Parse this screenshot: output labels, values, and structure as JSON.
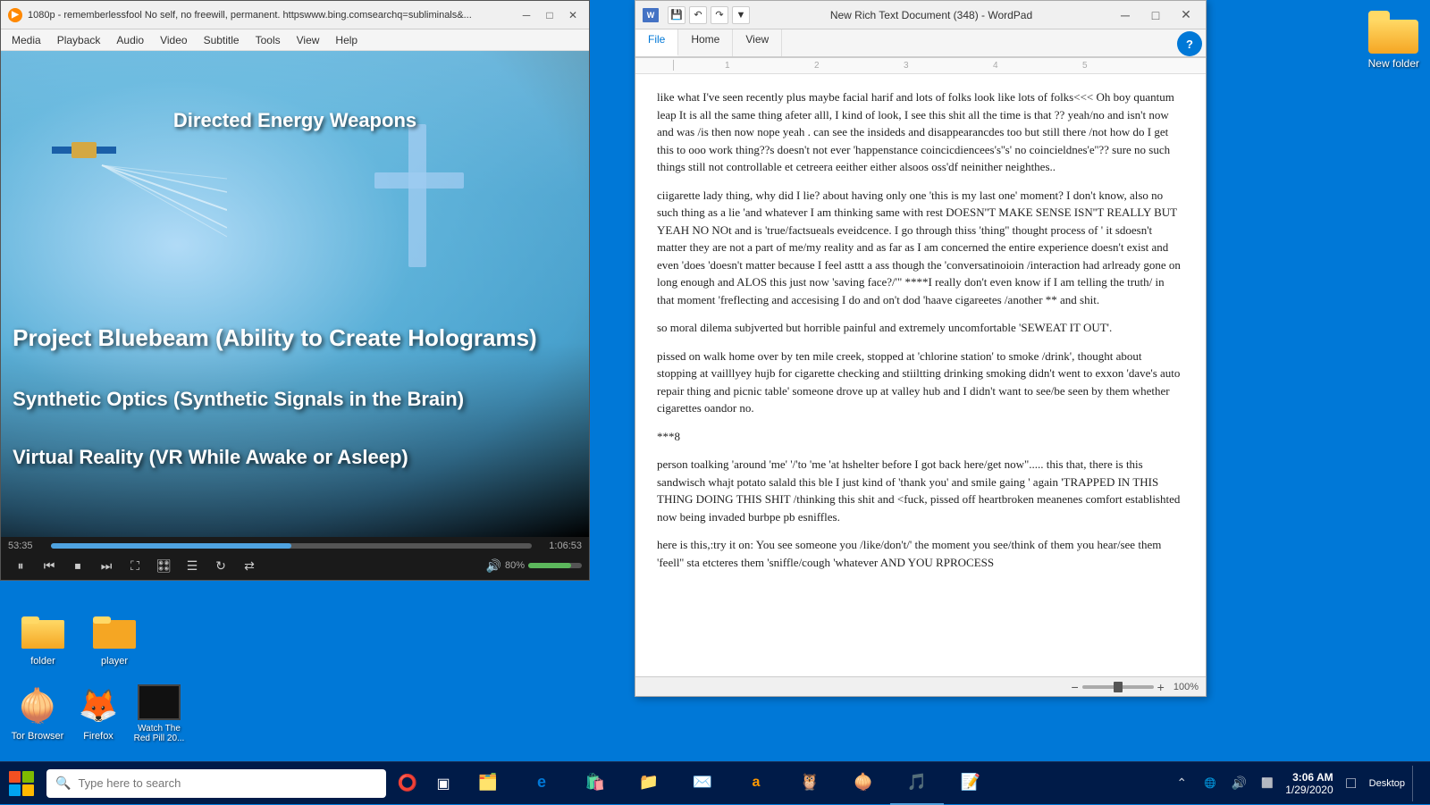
{
  "vlc": {
    "title": "1080p - rememberlessfool No self, no freewill, permanent. httpswww.bing.comsearchq=subliminals&...",
    "menu": {
      "items": [
        "Media",
        "Playback",
        "Audio",
        "Video",
        "Subtitle",
        "Tools",
        "View",
        "Help"
      ]
    },
    "video": {
      "text_directed": "Directed Energy Weapons",
      "text_project": "Project Bluebeam (Ability to Create Holograms)",
      "text_synthetic": "Synthetic Optics (Synthetic Signals in the Brain)",
      "text_vr": "Virtual Reality (VR While Awake or Asleep)"
    },
    "controls": {
      "current_time": "53:35",
      "total_time": "1:06:53",
      "volume_percent": "80%",
      "progress_percent": 50
    }
  },
  "wordpad": {
    "title": "New Rich Text Document (348) - WordPad",
    "tabs": [
      "File",
      "Home",
      "View"
    ],
    "active_tab": "File",
    "zoom_level": "100%",
    "content": [
      "like what I've seen recently plus maybe facial harif and lots of folks look like lots of folks<<< Oh boy quantum leap It is all the same thing afeter alll, I kind of look, I see this shit all the time is that ?? yeah/no and isn't now and was /is then now nope yeah . can see the insideds and disappearancdes too but still there /not how do I get this to ooo work thing??s doesn't not ever 'happenstance coincicdiencees's''s' no coincieldnes'e''?? sure no such things still not controllable et cetreera eeither either alsoos oss'df neinither neighthes..",
      "ciigarette lady thing, why did I lie? about having only one 'this is my last one' moment? I don't know, also no such thing as a lie 'and whatever I am thinking same with rest DOESN''T MAKE SENSE ISN''T REALLY BUT YEAH NO NOt and is 'true/factsueals eveidcence. I go through thiss 'thing'' thought process of ' it sdoesn't matter they are not a part of me/my reality and as far as I am concerned the entire experience doesn't exist and even 'does 'doesn't matter because I feel asttt a ass though the 'conversatinoioin /interaction had arlready gone on long enough and ALOS this just now 'saving face?/'\" ****I really don't even know if I am telling the truth/ in that moment 'freflecting and accesising I do and on't dod 'haave cigareetes /another ** and shit.",
      "so moral dilema subjverted but horrible painful and extremely uncomfortable 'SEWEAT IT OUT'.",
      "pissed on walk home over by ten mile creek, stopped at 'chlorine station' to smoke /drink', thought about stopping at vailllyey hujb for cigarette checking and stiiltting drinking smoking didn't went to exxon 'dave's auto repair thing and picnic table' someone drove up at valley hub and I didn't want to see/be seen by them whether cigarettes oandor no.",
      "***8",
      "person toalking 'around 'me' '/'to 'me 'at hshelter before I got back here/get now\"..... this that, there is this sandwisch whajt potato salald this ble I just kind of 'thank you' and smile gaing ' again 'TRAPPED IN THIS THING DOING THIS SHIT /thinking this shit and <fuck, pissed off heartbroken meanenes comfort establishted now being invaded burbpe pb esniffles.",
      "here is this,:try it on: You see someone you /like/don't/' the moment you see/think of them you hear/see them 'feell'' sta etcteres them 'sniffle/cough 'whatever AND YOU RPROCESS"
    ]
  },
  "desktop": {
    "icons": [
      {
        "id": "tor-browser",
        "label": "Tor Browser",
        "icon": "🧅"
      },
      {
        "id": "firefox",
        "label": "Firefox",
        "icon": "🦊"
      },
      {
        "id": "watch-redpill",
        "label": "Watch The Red Pill 20...",
        "icon": "📺"
      }
    ],
    "folders": [
      {
        "id": "folder",
        "label": "folder"
      },
      {
        "id": "player",
        "label": "player"
      }
    ]
  },
  "taskbar": {
    "search_placeholder": "Type here to search",
    "apps": [
      {
        "id": "explorer",
        "label": "",
        "icon": "🗂️",
        "active": false
      },
      {
        "id": "edge",
        "label": "",
        "icon": "e",
        "active": false
      },
      {
        "id": "store",
        "label": "",
        "icon": "🛍️",
        "active": false
      },
      {
        "id": "files",
        "label": "",
        "icon": "📁",
        "active": false
      },
      {
        "id": "mail",
        "label": "",
        "icon": "✉️",
        "active": false
      },
      {
        "id": "amazon",
        "label": "",
        "icon": "a",
        "active": false
      },
      {
        "id": "tripadvisor",
        "label": "",
        "icon": "🦉",
        "active": false
      },
      {
        "id": "tor-tb",
        "label": "",
        "icon": "🧅",
        "active": false
      },
      {
        "id": "vlc-tb",
        "label": "",
        "icon": "🎵",
        "active": true
      },
      {
        "id": "wp-tb",
        "label": "",
        "icon": "📝",
        "active": false
      }
    ],
    "clock": {
      "time": "3:06 AM",
      "date": "1/29/2020"
    },
    "location": "Desktop"
  },
  "new_folder": {
    "label": "New folder"
  }
}
